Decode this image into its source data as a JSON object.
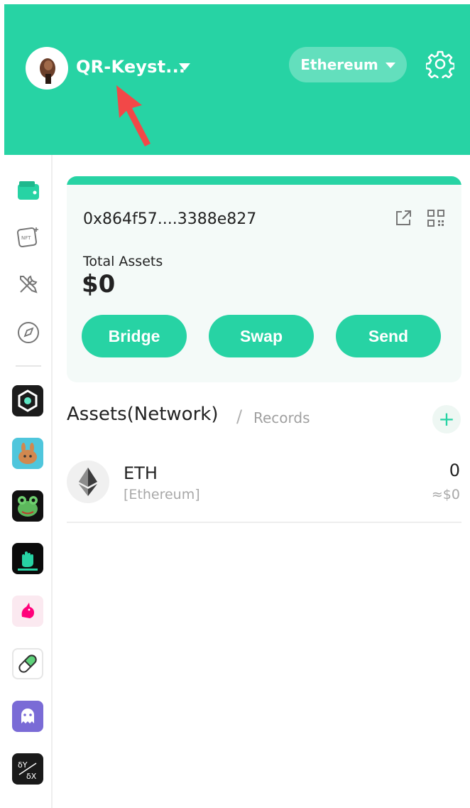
{
  "header": {
    "account_name": "QR-Keyst...",
    "network": "Ethereum",
    "accent_color": "#27d3a4"
  },
  "sidebar": {
    "nav_icons": [
      "wallet-icon",
      "nft-icon",
      "tools-icon",
      "compass-icon"
    ],
    "dapp_icons": [
      "dapp-cube-icon",
      "pancakeswap-icon",
      "frog-icon",
      "hand-icon",
      "unicorn-icon",
      "pill-icon",
      "ghost-icon",
      "fraction-icon"
    ]
  },
  "wallet_card": {
    "address": "0x864f57....3388e827",
    "total_assets_label": "Total Assets",
    "total_assets_value": "$0",
    "buttons": {
      "bridge": "Bridge",
      "swap": "Swap",
      "send": "Send"
    }
  },
  "assets_section": {
    "title": "Assets(Network)",
    "separator": "/",
    "records_label": "Records",
    "add_symbol": "+"
  },
  "assets": [
    {
      "symbol": "ETH",
      "network": "[Ethereum]",
      "amount": "0",
      "fiat": "≈$0"
    }
  ]
}
